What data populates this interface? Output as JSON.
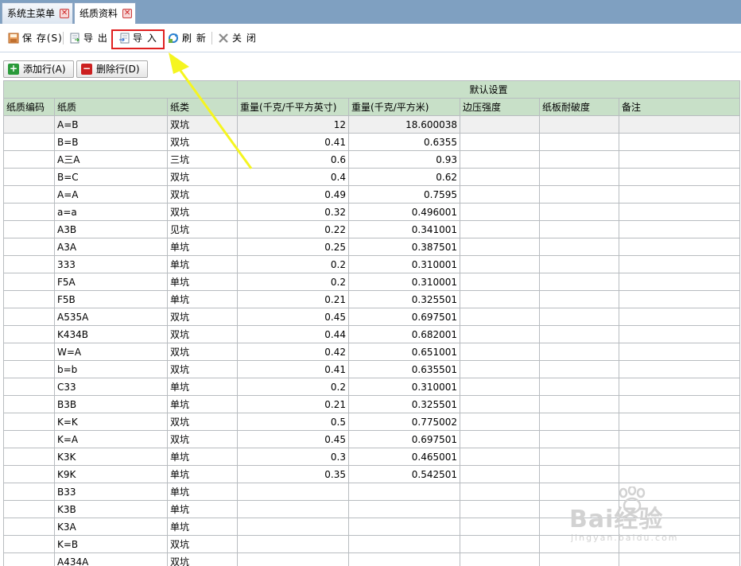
{
  "tabs": [
    {
      "label": "系统主菜单",
      "close": "✕"
    },
    {
      "label": "纸质资料",
      "close": "✕"
    }
  ],
  "toolbar": {
    "save": "保 存(S)",
    "export": "导 出",
    "import": "导 入",
    "refresh": "刷 新",
    "close": "关 闭"
  },
  "actions": {
    "add_row": "添加行(A)",
    "delete_row": "删除行(D)"
  },
  "table": {
    "group_header": "默认设置",
    "columns": [
      "纸质编码",
      "纸质",
      "纸类",
      "重量(千克/千平方英寸)",
      "重量(千克/平方米)",
      "边压强度",
      "纸板耐破度",
      "备注"
    ],
    "rows": [
      [
        "",
        "A=B",
        "双坑",
        "12",
        "18.600038",
        "",
        "",
        ""
      ],
      [
        "",
        "B=B",
        "双坑",
        "0.41",
        "0.6355",
        "",
        "",
        ""
      ],
      [
        "",
        "A三A",
        "三坑",
        "0.6",
        "0.93",
        "",
        "",
        ""
      ],
      [
        "",
        "B=C",
        "双坑",
        "0.4",
        "0.62",
        "",
        "",
        ""
      ],
      [
        "",
        "A=A",
        "双坑",
        "0.49",
        "0.7595",
        "",
        "",
        ""
      ],
      [
        "",
        "a=a",
        "双坑",
        "0.32",
        "0.496001",
        "",
        "",
        ""
      ],
      [
        "",
        "A3B",
        "见坑",
        "0.22",
        "0.341001",
        "",
        "",
        ""
      ],
      [
        "",
        "A3A",
        "单坑",
        "0.25",
        "0.387501",
        "",
        "",
        ""
      ],
      [
        "",
        "333",
        "单坑",
        "0.2",
        "0.310001",
        "",
        "",
        ""
      ],
      [
        "",
        "F5A",
        "单坑",
        "0.2",
        "0.310001",
        "",
        "",
        ""
      ],
      [
        "",
        "F5B",
        "单坑",
        "0.21",
        "0.325501",
        "",
        "",
        ""
      ],
      [
        "",
        "A535A",
        "双坑",
        "0.45",
        "0.697501",
        "",
        "",
        ""
      ],
      [
        "",
        "K434B",
        "双坑",
        "0.44",
        "0.682001",
        "",
        "",
        ""
      ],
      [
        "",
        "W=A",
        "双坑",
        "0.42",
        "0.651001",
        "",
        "",
        ""
      ],
      [
        "",
        "b=b",
        "双坑",
        "0.41",
        "0.635501",
        "",
        "",
        ""
      ],
      [
        "",
        "C33",
        "单坑",
        "0.2",
        "0.310001",
        "",
        "",
        ""
      ],
      [
        "",
        "B3B",
        "单坑",
        "0.21",
        "0.325501",
        "",
        "",
        ""
      ],
      [
        "",
        "K=K",
        "双坑",
        "0.5",
        "0.775002",
        "",
        "",
        ""
      ],
      [
        "",
        "K=A",
        "双坑",
        "0.45",
        "0.697501",
        "",
        "",
        ""
      ],
      [
        "",
        "K3K",
        "单坑",
        "0.3",
        "0.465001",
        "",
        "",
        ""
      ],
      [
        "",
        "K9K",
        "单坑",
        "0.35",
        "0.542501",
        "",
        "",
        ""
      ],
      [
        "",
        "B33",
        "单坑",
        "",
        "",
        "",
        "",
        ""
      ],
      [
        "",
        "K3B",
        "单坑",
        "",
        "",
        "",
        "",
        ""
      ],
      [
        "",
        "K3A",
        "单坑",
        "",
        "",
        "",
        "",
        ""
      ],
      [
        "",
        "K=B",
        "双坑",
        "",
        "",
        "",
        "",
        ""
      ],
      [
        "",
        "A434A",
        "双坑",
        "",
        "",
        "",
        "",
        ""
      ]
    ]
  },
  "watermark": {
    "brand": "Bai经验",
    "url": "jingyan.baidu.com"
  },
  "colors": {
    "tabbar": "#7fa0c1",
    "header": "#c8e0c8",
    "highlight": "#e02020",
    "arrow": "#f5f520"
  }
}
